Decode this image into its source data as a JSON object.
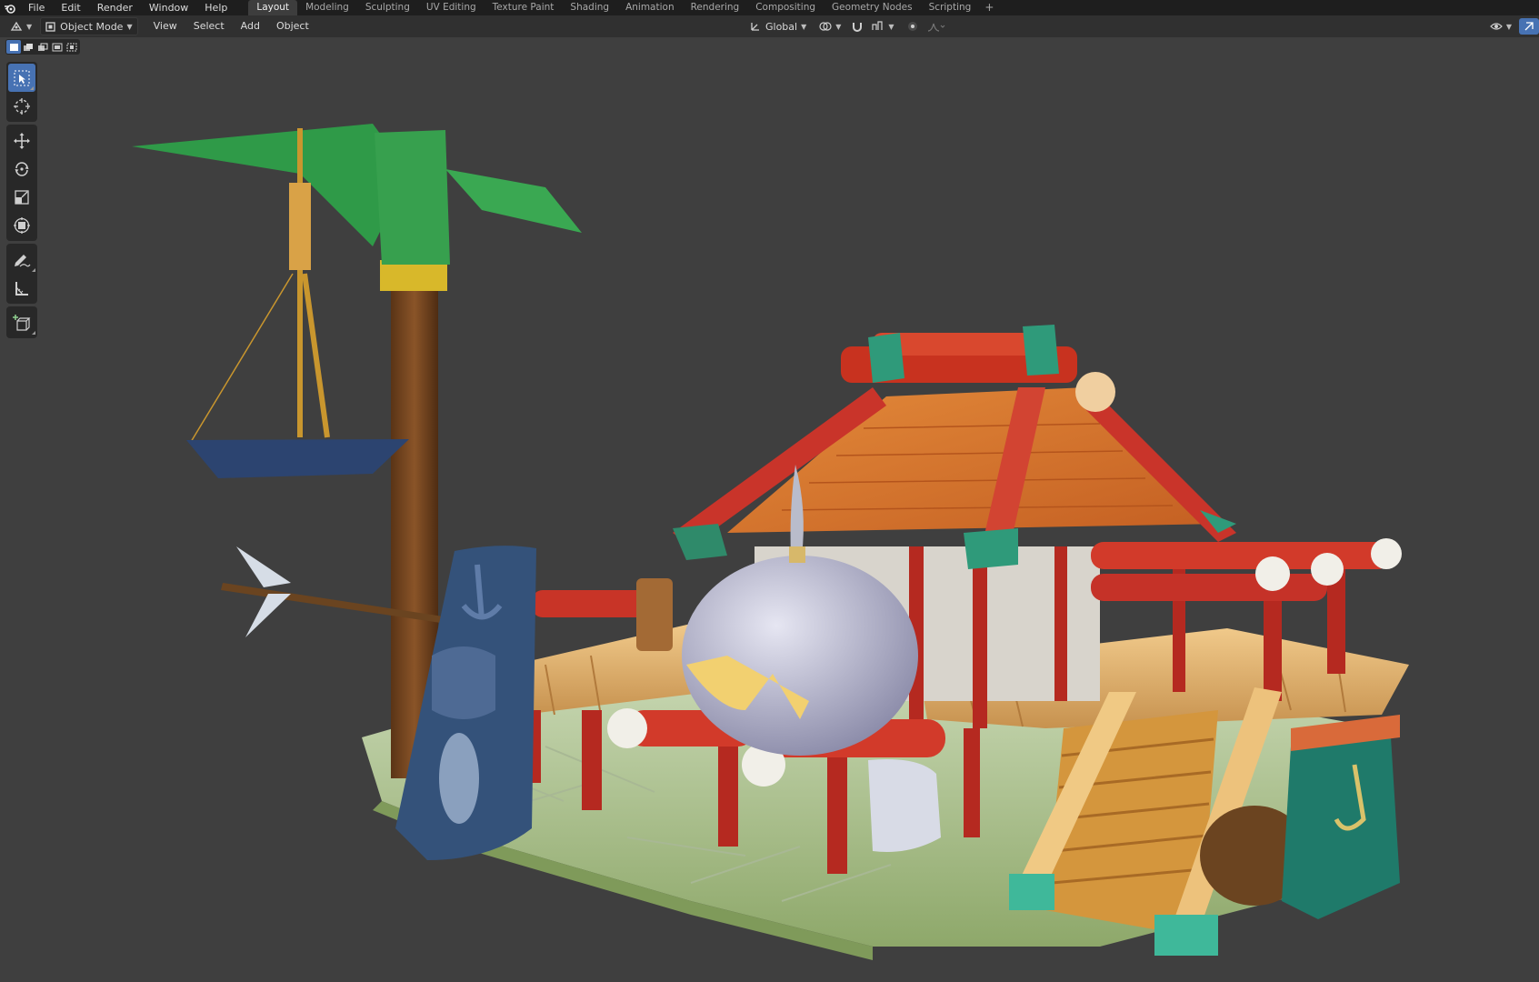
{
  "menubar": {
    "items": [
      "File",
      "Edit",
      "Render",
      "Window",
      "Help"
    ]
  },
  "workspaces": {
    "tabs": [
      "Layout",
      "Modeling",
      "Sculpting",
      "UV Editing",
      "Texture Paint",
      "Shading",
      "Animation",
      "Rendering",
      "Compositing",
      "Geometry Nodes",
      "Scripting"
    ],
    "active": "Layout",
    "add_label": "+"
  },
  "viewport_header": {
    "mode": "Object Mode",
    "menus": [
      "View",
      "Select",
      "Add",
      "Object"
    ],
    "orientation": "Global"
  },
  "toolbar": {
    "tools": [
      "select-box",
      "cursor",
      "move",
      "rotate",
      "scale",
      "transform",
      "annotate",
      "measure",
      "add-cube"
    ],
    "active": "select-box"
  },
  "colors": {
    "menubar_bg": "#1e1e1e",
    "header_bg": "#303030",
    "viewport_bg": "#3f3f3f",
    "accent": "#4772b3"
  }
}
